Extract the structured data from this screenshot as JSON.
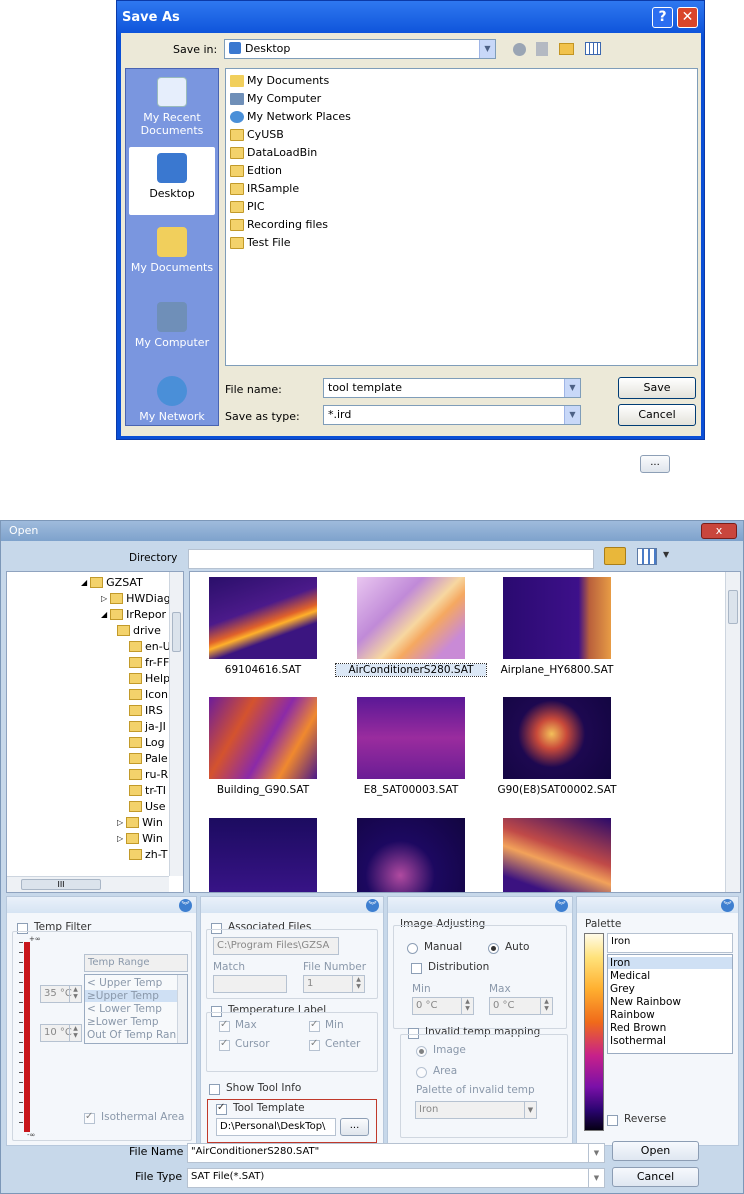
{
  "save_dialog": {
    "title": "Save As",
    "save_in_label": "Save in:",
    "save_in_value": "Desktop",
    "places": [
      {
        "label": "My Recent Documents"
      },
      {
        "label": "Desktop"
      },
      {
        "label": "My Documents"
      },
      {
        "label": "My Computer"
      },
      {
        "label": "My Network"
      }
    ],
    "files": [
      {
        "name": "My Documents",
        "icon": "documents-icon"
      },
      {
        "name": "My Computer",
        "icon": "computer-icon"
      },
      {
        "name": "My Network Places",
        "icon": "network-icon"
      },
      {
        "name": "CyUSB",
        "icon": "folder-icon"
      },
      {
        "name": "DataLoadBin",
        "icon": "folder-icon"
      },
      {
        "name": "Edtion",
        "icon": "folder-icon"
      },
      {
        "name": "IRSample",
        "icon": "folder-icon"
      },
      {
        "name": "PIC",
        "icon": "folder-icon"
      },
      {
        "name": "Recording files",
        "icon": "folder-icon"
      },
      {
        "name": "Test File",
        "icon": "folder-icon"
      }
    ],
    "file_name_label": "File name:",
    "file_name_value": "tool template",
    "save_type_label": "Save as type:",
    "save_type_value": "*.ird",
    "save_button": "Save",
    "cancel_button": "Cancel"
  },
  "browse_button": "...",
  "open_dialog": {
    "title": "Open",
    "close": "x",
    "directory_label": "Directory",
    "directory_value": "",
    "tree": [
      {
        "label": "GZSAT",
        "level": 0
      },
      {
        "label": "HWDiag",
        "level": 1
      },
      {
        "label": "IrRepor",
        "level": 1
      },
      {
        "label": "drive",
        "level": 2
      },
      {
        "label": "en-U",
        "level": 2
      },
      {
        "label": "fr-FF",
        "level": 2
      },
      {
        "label": "Help",
        "level": 2
      },
      {
        "label": "Icon",
        "level": 2
      },
      {
        "label": "IRS",
        "level": 2
      },
      {
        "label": "ja-JI",
        "level": 2
      },
      {
        "label": "Log",
        "level": 2
      },
      {
        "label": "Pale",
        "level": 2
      },
      {
        "label": "ru-R",
        "level": 2
      },
      {
        "label": "tr-TI",
        "level": 2
      },
      {
        "label": "Use",
        "level": 2
      },
      {
        "label": "Win",
        "level": 2
      },
      {
        "label": "Win",
        "level": 2
      },
      {
        "label": "zh-T",
        "level": 2
      }
    ],
    "tree_scroll_text": "III",
    "thumbnails": [
      {
        "caption": "69104616.SAT",
        "selected": false
      },
      {
        "caption": "AirConditionerS280.SAT",
        "selected": true
      },
      {
        "caption": "Airplane_HY6800.SAT",
        "selected": false
      },
      {
        "caption": "Building_G90.SAT",
        "selected": false
      },
      {
        "caption": "E8_SAT00003.SAT",
        "selected": false
      },
      {
        "caption": "G90(E8)SAT00002.SAT",
        "selected": false
      }
    ],
    "temp_filter": {
      "label": "Temp Filter",
      "scale_top": "+∞",
      "scale_bottom": "-∞",
      "range_header": "Temp Range",
      "range_options": [
        "< Upper Temp",
        "≥Upper Temp",
        "< Lower Temp",
        "≥Lower Temp",
        "Out Of Temp Ran"
      ],
      "upper_value": "35 °C",
      "lower_value": "10 °C",
      "isothermal_label": "Isothermal Area"
    },
    "associated": {
      "label": "Associated Files",
      "path": "C:\\Program Files\\GZSA",
      "match_label": "Match",
      "file_number_label": "File Number",
      "file_number_value": "1"
    },
    "temp_label": {
      "label": "Temperature Label",
      "max": "Max",
      "min": "Min",
      "cursor": "Cursor",
      "center": "Center"
    },
    "show_tool_info": "Show Tool Info",
    "tool_template": {
      "label": "Tool Template",
      "path": "D:\\Personal\\DeskTop\\",
      "browse": "..."
    },
    "image_adjusting": {
      "label": "Image Adjusting",
      "manual": "Manual",
      "auto": "Auto",
      "distribution": "Distribution",
      "min_label": "Min",
      "max_label": "Max",
      "min_value": "0 °C",
      "max_value": "0 °C",
      "invalid_label": "Invalid temp mapping",
      "image_opt": "Image",
      "area_opt": "Area",
      "palette_invalid_label": "Palette of invalid temp",
      "palette_invalid_value": "Iron"
    },
    "palette": {
      "label": "Palette",
      "value": "Iron",
      "options": [
        "Iron",
        "Medical",
        "Grey",
        "New Rainbow",
        "Rainbow",
        "Red Brown",
        "Isothermal"
      ],
      "reverse": "Reverse"
    },
    "file_name_label": "File Name",
    "file_name_value": "\"AirConditionerS280.SAT\"",
    "file_type_label": "File Type",
    "file_type_value": "SAT File(*.SAT)",
    "open_button": "Open",
    "cancel_button": "Cancel"
  }
}
